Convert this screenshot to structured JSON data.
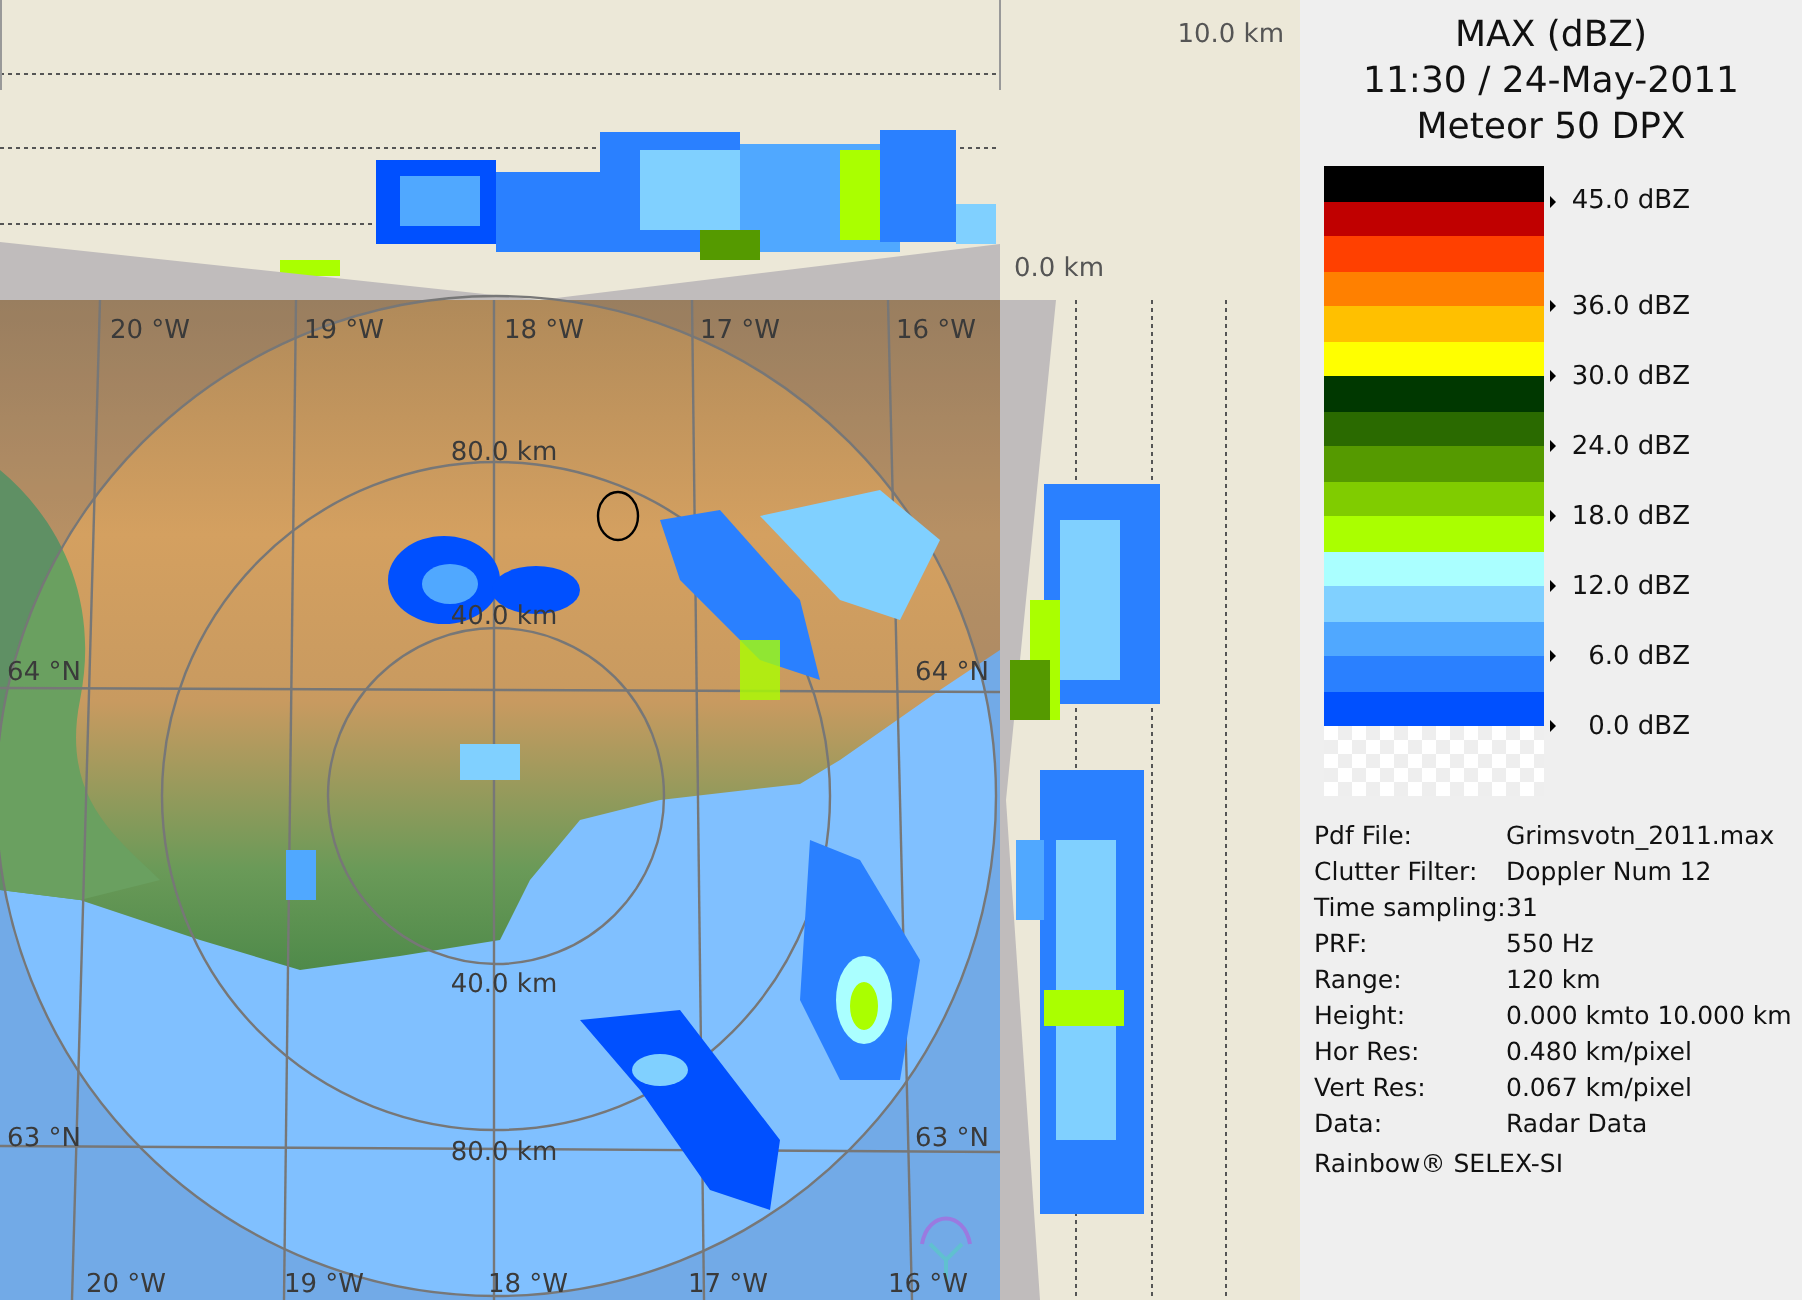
{
  "cross_section": {
    "height_labels": [
      "10.0 km",
      "0.0 km"
    ]
  },
  "map": {
    "longitude_labels_top": [
      "20 °W",
      "19 °W",
      "18 °W",
      "17 °W",
      "16 °W"
    ],
    "longitude_labels_bottom": [
      "20 °W",
      "19 °W",
      "18 °W",
      "17 °W",
      "16 °W"
    ],
    "latitude_labels": [
      "64 °N",
      "64 °N",
      "63 °N",
      "63 °N"
    ],
    "range_labels": [
      "80.0 km",
      "40.0 km",
      "40.0 km",
      "80.0 km"
    ]
  },
  "header": {
    "lines": [
      "MAX (dBZ)",
      "11:30 / 24-May-2011",
      "Meteor 50 DPX"
    ]
  },
  "legend": [
    {
      "color": "#000000",
      "tick": "45.0 dBZ"
    },
    {
      "color": "#c00000"
    },
    {
      "color": "#ff4000"
    },
    {
      "color": "#ff8000",
      "tick": "36.0 dBZ"
    },
    {
      "color": "#ffc000"
    },
    {
      "color": "#ffff00",
      "tick": "30.0 dBZ"
    },
    {
      "color": "#003800"
    },
    {
      "color": "#2a6a00",
      "tick": "24.0 dBZ"
    },
    {
      "color": "#559a00"
    },
    {
      "color": "#80cc00",
      "tick": "18.0 dBZ"
    },
    {
      "color": "#aaff00"
    },
    {
      "color": "#aaffff",
      "tick": "12.0 dBZ"
    },
    {
      "color": "#80d0ff"
    },
    {
      "color": "#50a8ff",
      "tick": "6.0 dBZ"
    },
    {
      "color": "#2a80ff"
    },
    {
      "color": "#0050ff",
      "tick": "0.0 dBZ"
    }
  ],
  "info": [
    {
      "label": "Pdf File:",
      "value": "Grimsvotn_2011.max"
    },
    {
      "label": "Clutter Filter:",
      "value": "Doppler Num 12"
    },
    {
      "label": "Time sampling:",
      "value": "31"
    },
    {
      "label": "PRF:",
      "value": "550 Hz"
    },
    {
      "label": "Range:",
      "value": "120 km"
    },
    {
      "label": "Height:",
      "value": "0.000 kmto 10.000 km"
    },
    {
      "label": "Hor Res:",
      "value": "0.480 km/pixel"
    },
    {
      "label": "Vert Res:",
      "value": "0.067 km/pixel"
    },
    {
      "label": "Data:",
      "value": "Radar Data"
    }
  ],
  "footer": "Rainbow® SELEX-SI"
}
